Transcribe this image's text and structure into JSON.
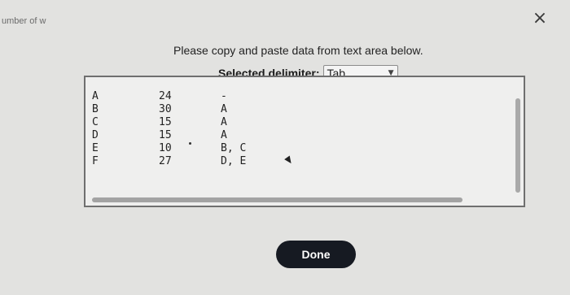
{
  "background_fragment": "umber of w",
  "close_icon": "×",
  "instruction": "Please copy and paste data from text area below.",
  "delimiter": {
    "label": "Selected delimiter:",
    "selected": "Tab"
  },
  "textarea": {
    "rows": [
      {
        "task": "A",
        "time": "24",
        "predecessor": "-"
      },
      {
        "task": "B",
        "time": "30",
        "predecessor": "A"
      },
      {
        "task": "C",
        "time": "15",
        "predecessor": "A"
      },
      {
        "task": "D",
        "time": "15",
        "predecessor": "A"
      },
      {
        "task": "E",
        "time": "10",
        "predecessor": "B, C"
      },
      {
        "task": "F",
        "time": "27",
        "predecessor": "D, E"
      }
    ]
  },
  "done_label": "Done"
}
